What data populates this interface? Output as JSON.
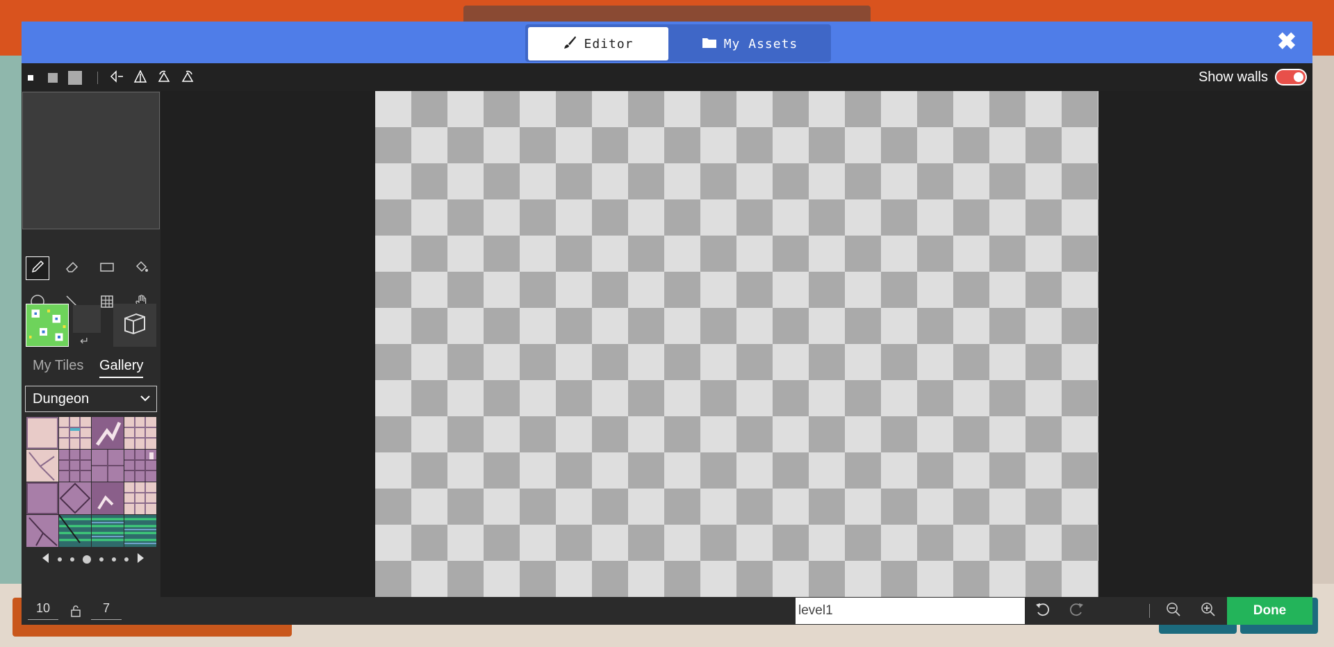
{
  "header": {
    "tabs": [
      {
        "label": "Editor",
        "icon": "brush-icon",
        "active": true
      },
      {
        "label": "My Assets",
        "icon": "folder-icon",
        "active": false
      }
    ],
    "close_icon": "close-icon"
  },
  "toolbar": {
    "show_walls_label": "Show walls",
    "show_walls_on": true
  },
  "tools": [
    "pencil",
    "eraser",
    "rectangle",
    "fill",
    "circle",
    "line",
    "grid",
    "hand"
  ],
  "palette": {
    "primary_color": "#6ed35b",
    "swap_icon": "↵"
  },
  "gallery": {
    "tabs": [
      "My Tiles",
      "Gallery"
    ],
    "selected_tab": "Gallery",
    "category": "Dungeon"
  },
  "canvas": {
    "width_tiles": "10",
    "height_tiles": "7",
    "level_name": "level1"
  },
  "actions": {
    "done_label": "Done"
  },
  "colors": {
    "header": "#4f7de8",
    "done": "#23b45a",
    "toggle": "#e8504a"
  }
}
